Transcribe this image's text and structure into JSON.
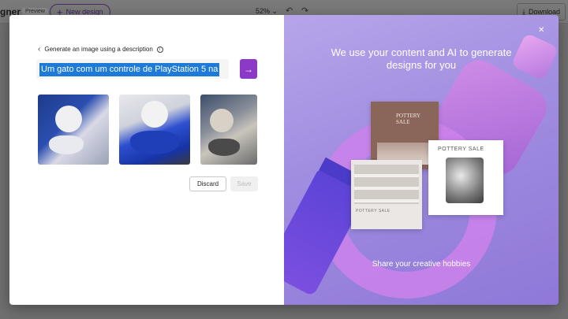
{
  "app": {
    "title": "gner",
    "badge": "Preview",
    "new_design_label": "New design",
    "zoom": "52%",
    "download_label": "Download"
  },
  "dialog": {
    "back_label": "Generate an image using a description",
    "prompt_value": "Um gato com um controle de PlayStation 5 na",
    "discard_label": "Discard",
    "save_label": "Save",
    "images": [
      {
        "name": "generated-image-1"
      },
      {
        "name": "generated-image-2"
      },
      {
        "name": "generated-image-3"
      }
    ]
  },
  "promo": {
    "headline": "We use your content and AI to generate designs for you",
    "card1_title": "POTTERY SALE",
    "card2_title": "POTTERY SALE",
    "card3_title": "POTTERY SALE",
    "footnote": "Share your creative hobbies"
  },
  "colors": {
    "accent": "#8c39c8",
    "selection": "#1d7ad9",
    "promo_bg": "#a08ce0"
  }
}
